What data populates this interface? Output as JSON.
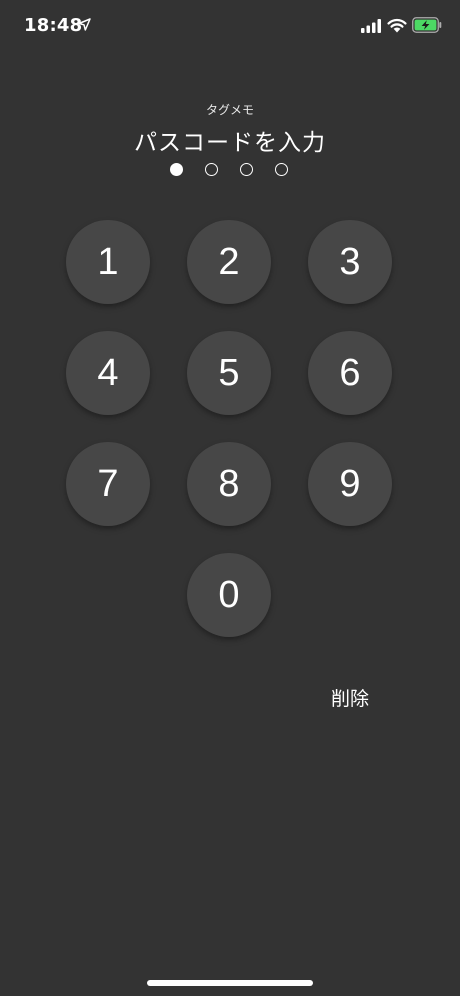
{
  "status_bar": {
    "time": "18:48",
    "battery_color": "#4cd964"
  },
  "header": {
    "app_name": "タグメモ",
    "prompt": "パスコードを入力"
  },
  "passcode": {
    "length": 4,
    "entered": 1
  },
  "keypad": {
    "k1": "1",
    "k2": "2",
    "k3": "3",
    "k4": "4",
    "k5": "5",
    "k6": "6",
    "k7": "7",
    "k8": "8",
    "k9": "9",
    "k0": "0",
    "delete_label": "削除"
  },
  "colors": {
    "background": "#333333",
    "key_background": "#474747",
    "text": "#ffffff"
  }
}
